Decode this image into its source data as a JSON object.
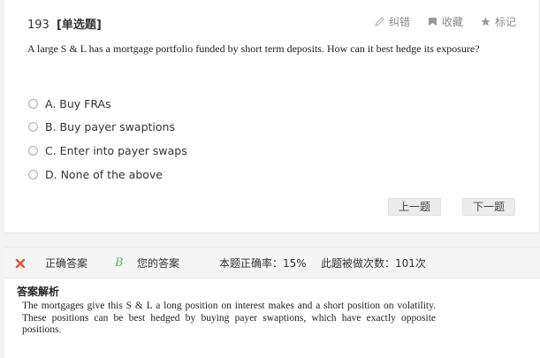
{
  "question": {
    "number": "193",
    "type": "[单选题]",
    "text": "A large S & L has a mortgage portfolio funded by short term deposits. How can it best hedge its exposure?",
    "options": [
      {
        "label": "A. Buy FRAs"
      },
      {
        "label": "B. Buy payer swaptions"
      },
      {
        "label": "C. Enter into payer swaps"
      },
      {
        "label": "D. None of the above"
      }
    ]
  },
  "toolbar": {
    "report": {
      "label": "纠错",
      "icon": "pencil-icon"
    },
    "favorite": {
      "label": "收藏",
      "icon": "bookmark-icon"
    },
    "mark": {
      "label": "标记",
      "icon": "star-icon"
    }
  },
  "navigation": {
    "prev_label": "上一题",
    "next_label": "下一题"
  },
  "result": {
    "correct_mark": "✕",
    "correct_label": "正确答案",
    "your_answer": "B",
    "your_label": "您的答案",
    "rate_text": "本题正确率：15%",
    "count_text": "此题被做次数：101次",
    "colors": {
      "wrong": "#e8552d",
      "yours": "#5cb85c"
    }
  },
  "explanation": {
    "title": "答案解析",
    "text": "The mortgages give this S & L a long position on interest makes and a short position on volatility. These positions can be best hedged by buying payer swaptions, which have exactly opposite positions."
  }
}
